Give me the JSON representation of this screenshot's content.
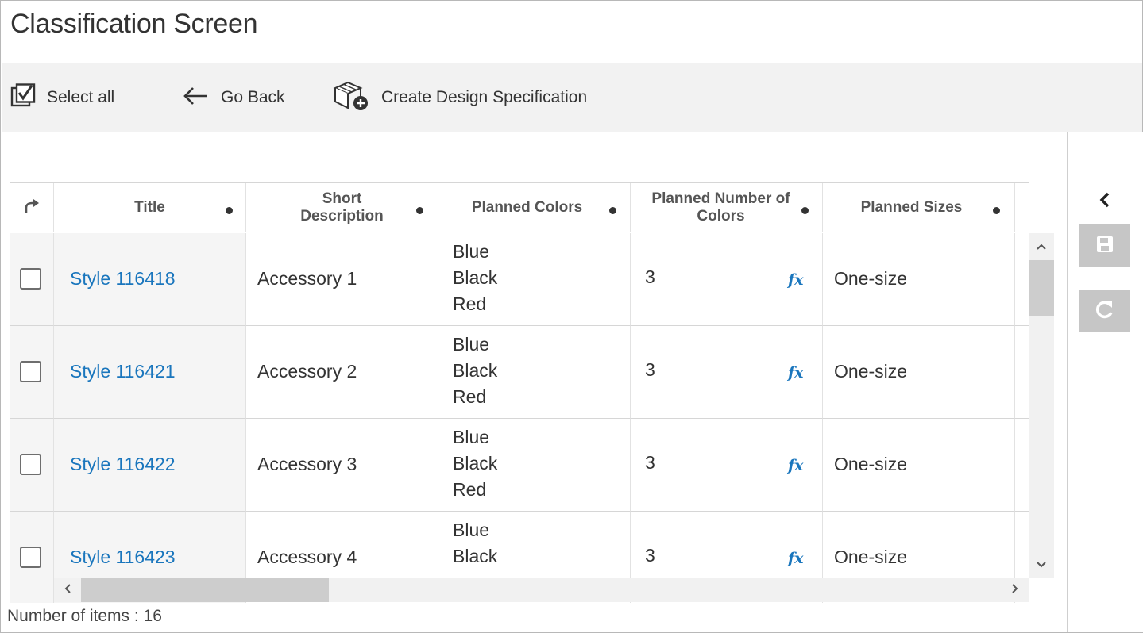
{
  "page": {
    "title": "Classification Screen"
  },
  "toolbar": {
    "select_all": "Select all",
    "go_back": "Go Back",
    "create_design_spec": "Create Design Specification"
  },
  "grid": {
    "columns": [
      {
        "label": ""
      },
      {
        "label": "Title"
      },
      {
        "label": "Short Description"
      },
      {
        "label": "Planned Colors"
      },
      {
        "label": "Planned Number of Colors"
      },
      {
        "label": "Planned Sizes"
      }
    ],
    "rows": [
      {
        "title": "Style 116418",
        "short_description": "Accessory 1",
        "planned_colors": [
          "Blue",
          "Black",
          "Red"
        ],
        "planned_number_of_colors": "3",
        "planned_sizes": "One-size"
      },
      {
        "title": "Style 116421",
        "short_description": "Accessory 2",
        "planned_colors": [
          "Blue",
          "Black",
          "Red"
        ],
        "planned_number_of_colors": "3",
        "planned_sizes": "One-size"
      },
      {
        "title": "Style 116422",
        "short_description": "Accessory 3",
        "planned_colors": [
          "Blue",
          "Black",
          "Red"
        ],
        "planned_number_of_colors": "3",
        "planned_sizes": "One-size"
      },
      {
        "title": "Style 116423",
        "short_description": "Accessory 4",
        "planned_colors": [
          "Blue",
          "Black"
        ],
        "planned_number_of_colors": "3",
        "planned_sizes": "One-size"
      }
    ],
    "formula_label": "fx"
  },
  "footer": {
    "item_count": "Number of items : 16"
  },
  "icons": {
    "select_all": "checkbox-check-icon",
    "go_back": "arrow-left-icon",
    "create": "box-plus-icon",
    "collapse": "chevron-left-icon",
    "save": "floppy-disk-icon",
    "refresh": "refresh-icon",
    "reset": "redo-arrow-icon"
  },
  "colors": {
    "link": "#1a76bd",
    "toolbar_bg": "#f2f2f2",
    "disabled_button": "#c6c6c6"
  }
}
